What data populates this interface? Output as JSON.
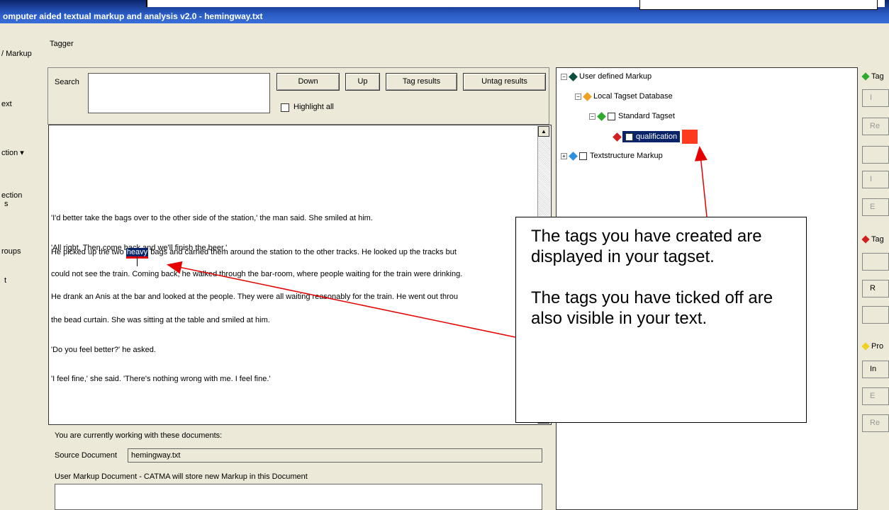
{
  "window": {
    "title": "omputer aided textual markup and analysis v2.0  - hemingway.txt"
  },
  "sidebar": {
    "items": [
      {
        "label": "/ Markup"
      },
      {
        "label": "ext"
      },
      {
        "label": "ction ▾"
      },
      {
        "label": "ection"
      },
      {
        "label": "s"
      },
      {
        "label": "roups"
      },
      {
        "label": "t"
      }
    ]
  },
  "tagger": {
    "tab_label": "Tagger"
  },
  "search": {
    "label": "Search",
    "value": "",
    "down_label": "Down",
    "up_label": "Up",
    "tag_results_label": "Tag results",
    "untag_results_label": "Untag results",
    "highlight_all_label": "Highlight all",
    "highlight_all_checked": false
  },
  "text": {
    "line1": "'I'd better take the bags over to the other side of the station,' the man said. She smiled at him.",
    "line2": "'All right. Then come back and we'll finish the beer.'",
    "line3_pre": "He picked up the two ",
    "line3_tag": "heavy",
    "line3_post": " bags and carried them around the station to the other tracks. He looked up the tracks but",
    "line4": "could not see the train. Coming back, he walked through the bar-room, where people waiting for the train were drinking.",
    "line5": "He drank an Anis at the bar and looked at the people. They were all waiting reasonably for the train. He went out throu",
    "line6": "the bead curtain. She was sitting at the table and smiled at him.",
    "line7": "'Do you feel better?' he asked.",
    "line8": "'I feel fine,' she said. 'There's nothing wrong with me. I feel fine.'"
  },
  "documents": {
    "info": "You are currently working with these documents:",
    "source_label": "Source Document",
    "source_value": "hemingway.txt",
    "user_markup_label": "User Markup Document - CATMA will store new Markup in this Document"
  },
  "tree": {
    "root": "User defined Markup",
    "local_db": "Local Tagset Database",
    "standard_tagset": "Standard Tagset",
    "qualification": "qualification",
    "textstructure": "Textstructure Markup"
  },
  "right_panel": {
    "head1": "Tag",
    "head2": "Tag",
    "head3": "Pro",
    "buttons": [
      "I",
      "Re",
      "",
      "I",
      "E",
      "",
      "R",
      "",
      "In",
      "E",
      "Re"
    ]
  },
  "callout": {
    "para1": "The tags you have created are displayed in your tagset.",
    "para2": "The tags you have ticked off are also visible in your text."
  },
  "colors": {
    "title_bar": "#0a246a",
    "selection": "#0a246a",
    "tag_color": "#ff3b1f",
    "arrow": "#e60000"
  }
}
